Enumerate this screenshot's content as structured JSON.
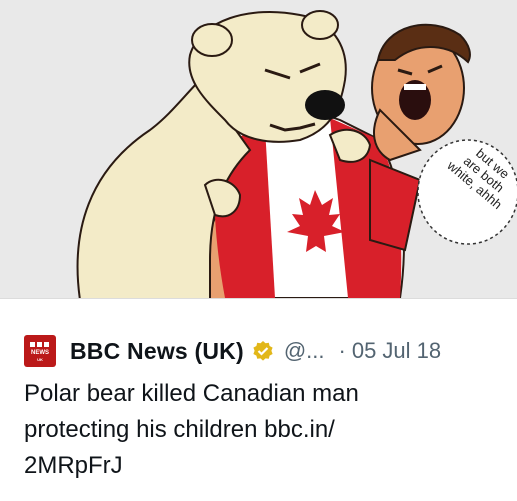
{
  "comic": {
    "bubble_lines": [
      "but we",
      "are both",
      "white, ahhh"
    ],
    "colors": {
      "background": "#e9e9e9",
      "bear": "#f3ebc8",
      "shirt_red": "#d8202a",
      "skin": "#e8a070"
    }
  },
  "tweet": {
    "avatar": {
      "line1": "BBC",
      "line2": "NEWS",
      "line3": "UK"
    },
    "author_name": "BBC News (UK)",
    "verified_icon": "gold-verified-badge-icon",
    "handle": "@...",
    "separator": "·",
    "date": "05 Jul 18",
    "text_line1": "Polar bear killed Canadian man",
    "text_line2": "protecting his children bbc.in/",
    "text_line3": "2MRpFrJ",
    "colors": {
      "brand": "#bb1919",
      "verified": "#e2b719",
      "text": "#0f1419",
      "muted": "#536471"
    }
  }
}
